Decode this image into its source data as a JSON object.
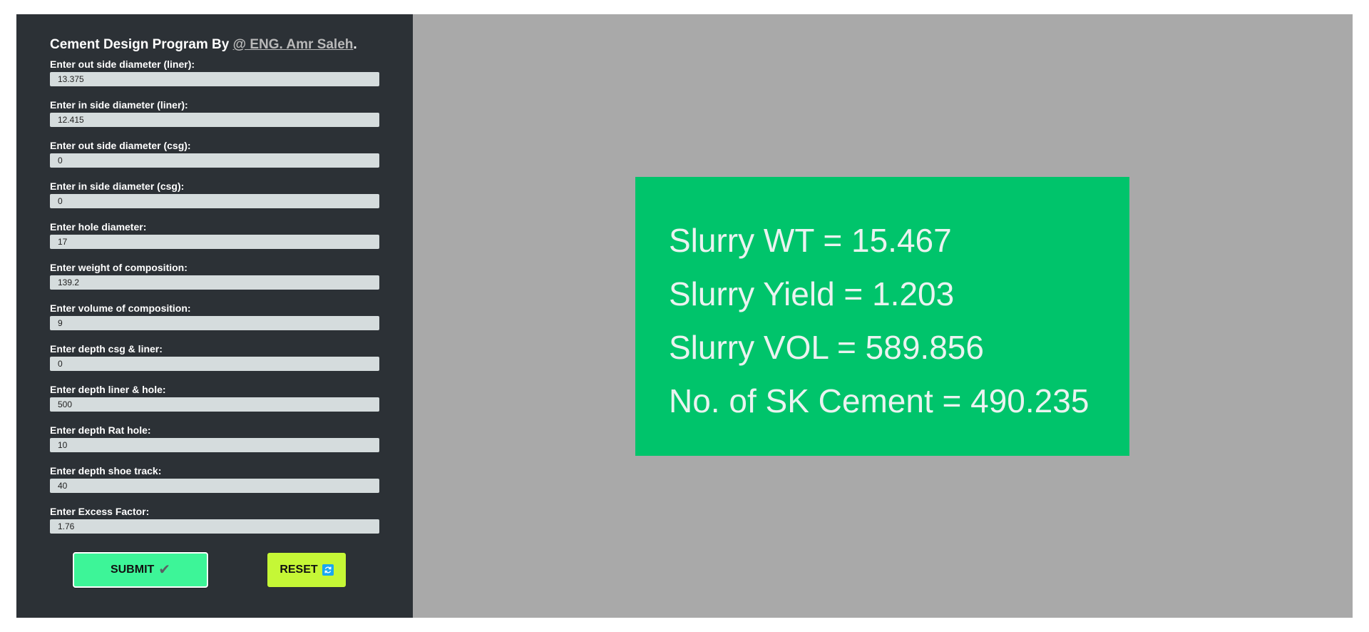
{
  "form": {
    "title_prefix": "Cement Design Program By ",
    "author_link": "@ ENG. Amr Saleh",
    "title_suffix": ".",
    "fields": [
      {
        "label": "Enter out side diameter (liner):",
        "value": "13.375"
      },
      {
        "label": "Enter in side diameter (liner):",
        "value": "12.415"
      },
      {
        "label": "Enter out side diameter (csg):",
        "value": "0"
      },
      {
        "label": "Enter in side diameter (csg):",
        "value": "0"
      },
      {
        "label": "Enter hole diameter:",
        "value": "17"
      },
      {
        "label": "Enter weight of composition:",
        "value": "139.2"
      },
      {
        "label": "Enter volume of composition:",
        "value": "9"
      },
      {
        "label": "Enter depth csg & liner:",
        "value": "0"
      },
      {
        "label": "Enter depth liner & hole:",
        "value": "500"
      },
      {
        "label": "Enter depth Rat hole:",
        "value": "10"
      },
      {
        "label": "Enter depth shoe track:",
        "value": "40"
      },
      {
        "label": "Enter Excess Factor:",
        "value": "1.76"
      }
    ],
    "submit_label": "SUBMIT",
    "submit_icon": "✔",
    "reset_label": "RESET",
    "reset_icon": "🔃"
  },
  "results": {
    "slurry_wt": "Slurry WT = 15.467",
    "slurry_yield": "Slurry Yield = 1.203",
    "slurry_vol": "Slurry VOL = 589.856",
    "sk_cement": "No. of SK Cement = 490.235"
  },
  "colors": {
    "form_background": "#2c3136",
    "output_background": "#a9a9a9",
    "result_card": "#00c46b",
    "submit_button": "#3df598",
    "reset_button": "#c5f736",
    "input_background": "#d5dcdd"
  }
}
